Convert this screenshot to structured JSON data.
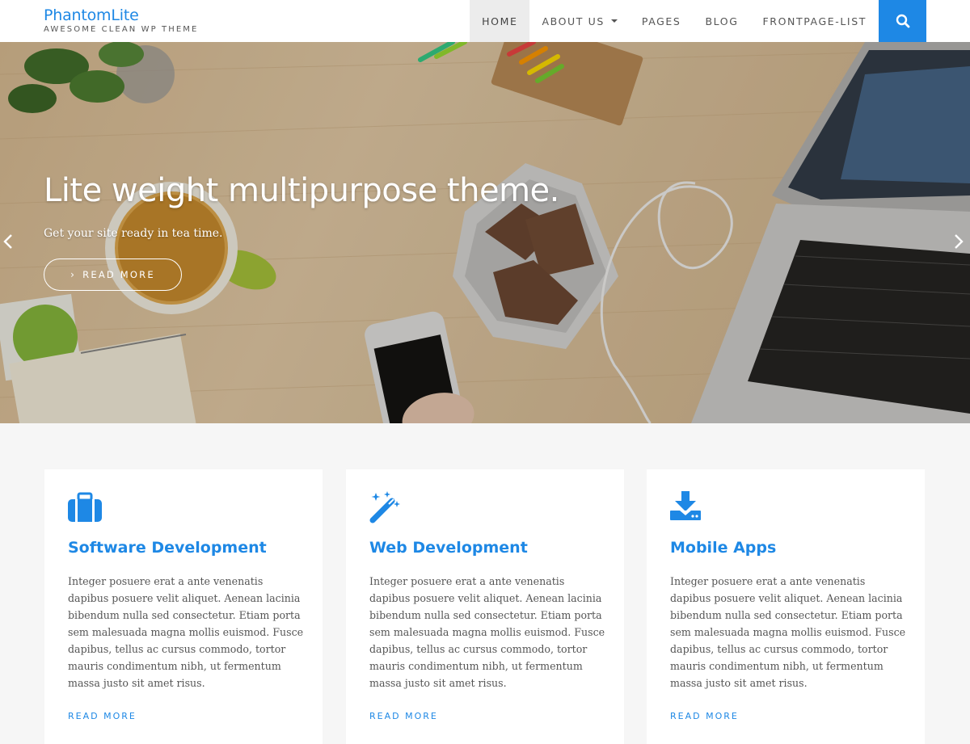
{
  "brand": {
    "title": "PhantomLite",
    "tagline": "AWESOME CLEAN WP THEME"
  },
  "nav": {
    "items": [
      {
        "label": "HOME",
        "active": true
      },
      {
        "label": "ABOUT US",
        "has_dropdown": true
      },
      {
        "label": "PAGES"
      },
      {
        "label": "BLOG"
      },
      {
        "label": "FRONTPAGE-LIST"
      }
    ],
    "search_icon": "search-icon"
  },
  "hero": {
    "title": "Lite weight multipurpose theme.",
    "subtitle": "Get your site ready in tea time.",
    "button_label": "READ MORE",
    "prev_icon": "chevron-left-icon",
    "next_icon": "chevron-right-icon"
  },
  "features": [
    {
      "icon": "briefcase-icon",
      "title": "Software Development",
      "text": "Integer posuere erat a ante venenatis dapibus posuere velit aliquet. Aenean lacinia bibendum nulla sed consectetur. Etiam porta sem malesuada magna mollis euismod. Fusce dapibus, tellus ac cursus commodo, tortor mauris condimentum nibh, ut fermentum massa justo sit amet risus.",
      "link": "READ MORE"
    },
    {
      "icon": "magic-wand-icon",
      "title": "Web Development",
      "text": "Integer posuere erat a ante venenatis dapibus posuere velit aliquet. Aenean lacinia bibendum nulla sed consectetur. Etiam porta sem malesuada magna mollis euismod. Fusce dapibus, tellus ac cursus commodo, tortor mauris condimentum nibh, ut fermentum massa justo sit amet risus.",
      "link": "READ MORE"
    },
    {
      "icon": "download-icon",
      "title": "Mobile Apps",
      "text": "Integer posuere erat a ante venenatis dapibus posuere velit aliquet. Aenean lacinia bibendum nulla sed consectetur. Etiam porta sem malesuada magna mollis euismod. Fusce dapibus, tellus ac cursus commodo, tortor mauris condimentum nibh, ut fermentum massa justo sit amet risus.",
      "link": "READ MORE"
    }
  ],
  "colors": {
    "accent": "#1e88e5",
    "background": "#f6f6f6",
    "card": "#ffffff",
    "nav_active": "#ececec"
  }
}
